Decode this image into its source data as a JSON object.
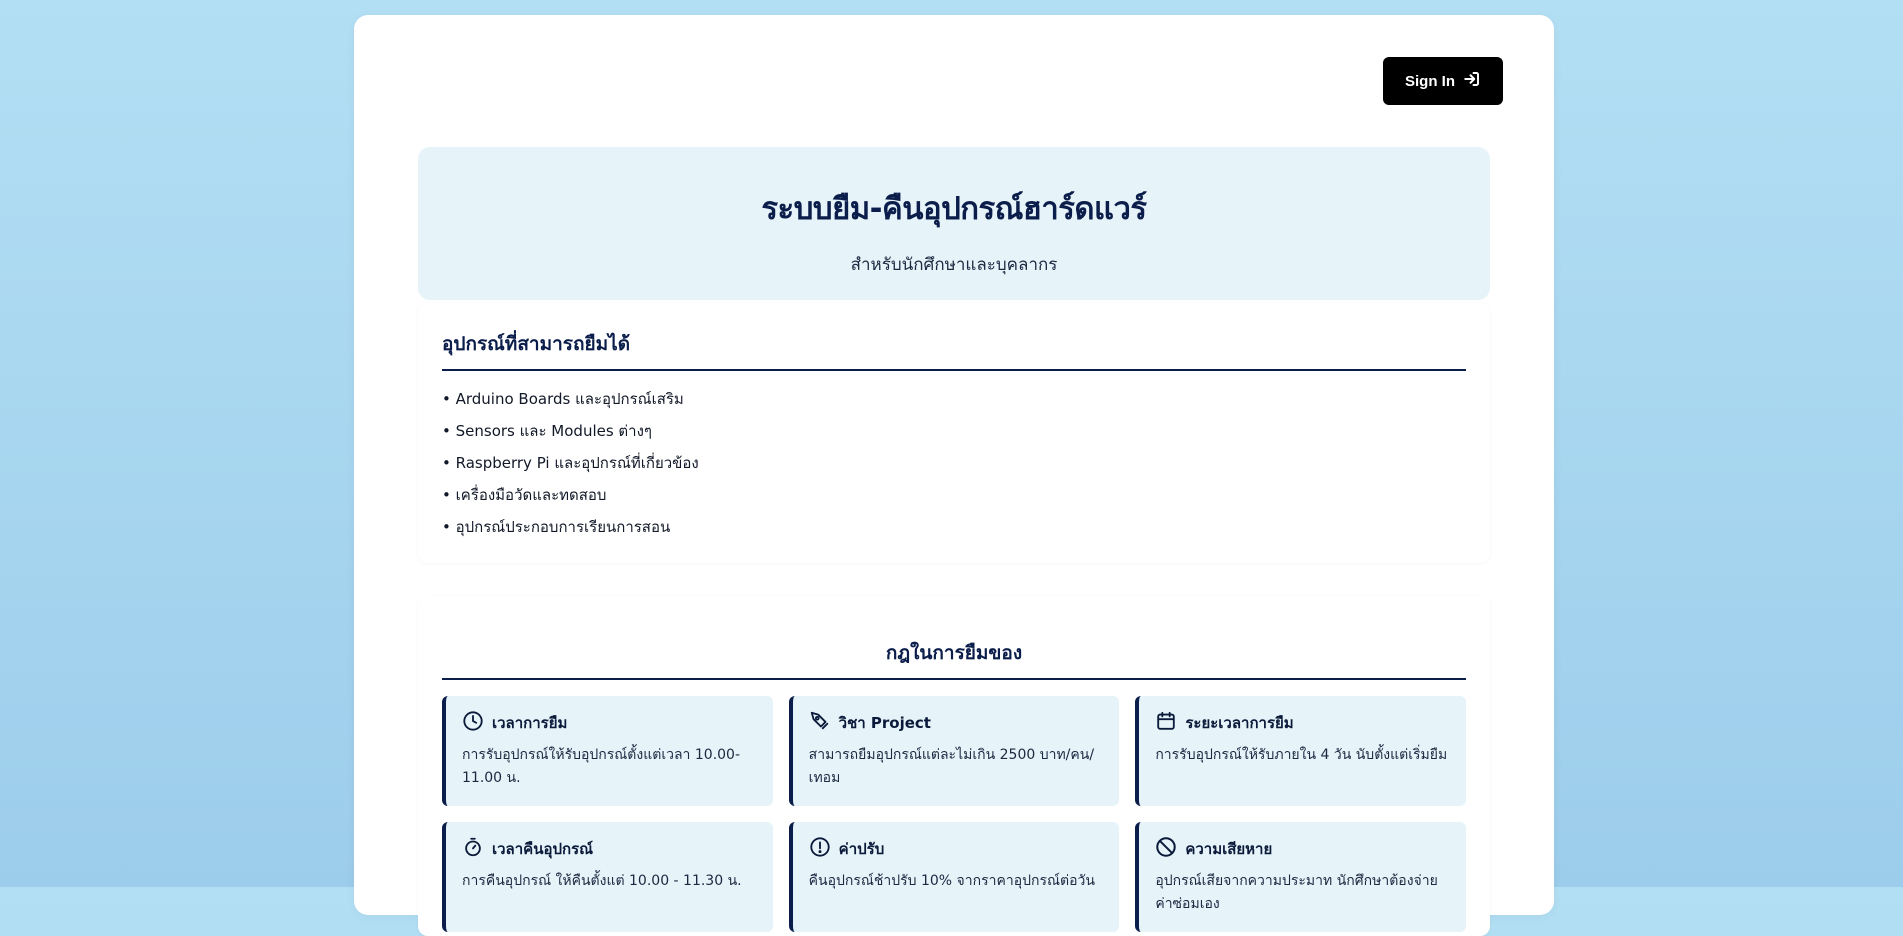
{
  "auth": {
    "signin_label": "Sign In",
    "signin_icon": "sign-in-icon"
  },
  "hero": {
    "title": "ระบบยืม-คืนอุปกรณ์ฮาร์ดแวร์",
    "subtitle": "สำหรับนักศึกษาและบุคลากร"
  },
  "equipment": {
    "heading": "อุปกรณ์ที่สามารถยืมได้",
    "items": [
      "• Arduino Boards และอุปกรณ์เสริม",
      "• Sensors และ Modules ต่างๆ",
      "• Raspberry Pi และอุปกรณ์ที่เกี่ยวข้อง",
      "• เครื่องมือวัดและทดสอบ",
      "• อุปกรณ์ประกอบการเรียนการสอน"
    ]
  },
  "rules": {
    "heading": "กฎในการยืมของ",
    "items": [
      {
        "icon": "clock-icon",
        "title": "เวลาการยืม",
        "text": "การรับอุปกรณ์ให้รับอุปกรณ์ตั้งแต่เวลา 10.00-11.00 น."
      },
      {
        "icon": "pen-tool-icon",
        "title": "วิชา Project",
        "text": "สามารถยืมอุปกรณ์แต่ละไม่เกิน 2500 บาท/คน/เทอม"
      },
      {
        "icon": "calendar-icon",
        "title": "ระยะเวลาการยืม",
        "text": "การรับอุปกรณ์ให้รับภายใน 4 วัน นับตั้งแต่เริ่มยืม"
      },
      {
        "icon": "stopwatch-icon",
        "title": "เวลาคืนอุปกรณ์",
        "text": "การคืนอุปกรณ์ ให้คืนตั้งแต่ 10.00 - 11.30 น."
      },
      {
        "icon": "exclamation-circle-icon",
        "title": "ค่าปรับ",
        "text": "คืนอุปกรณ์ช้าปรับ 10% จากราคาอุปกรณ์ต่อวัน"
      },
      {
        "icon": "ban-icon",
        "title": "ความเสียหาย",
        "text": "อุปกรณ์เสียจากความประมาท นักศึกษาต้องจ่ายค่าซ่อมเอง"
      }
    ]
  },
  "colors": {
    "accent": "#0b1d4a",
    "panel": "#e6f3f9",
    "button": "#000000"
  }
}
